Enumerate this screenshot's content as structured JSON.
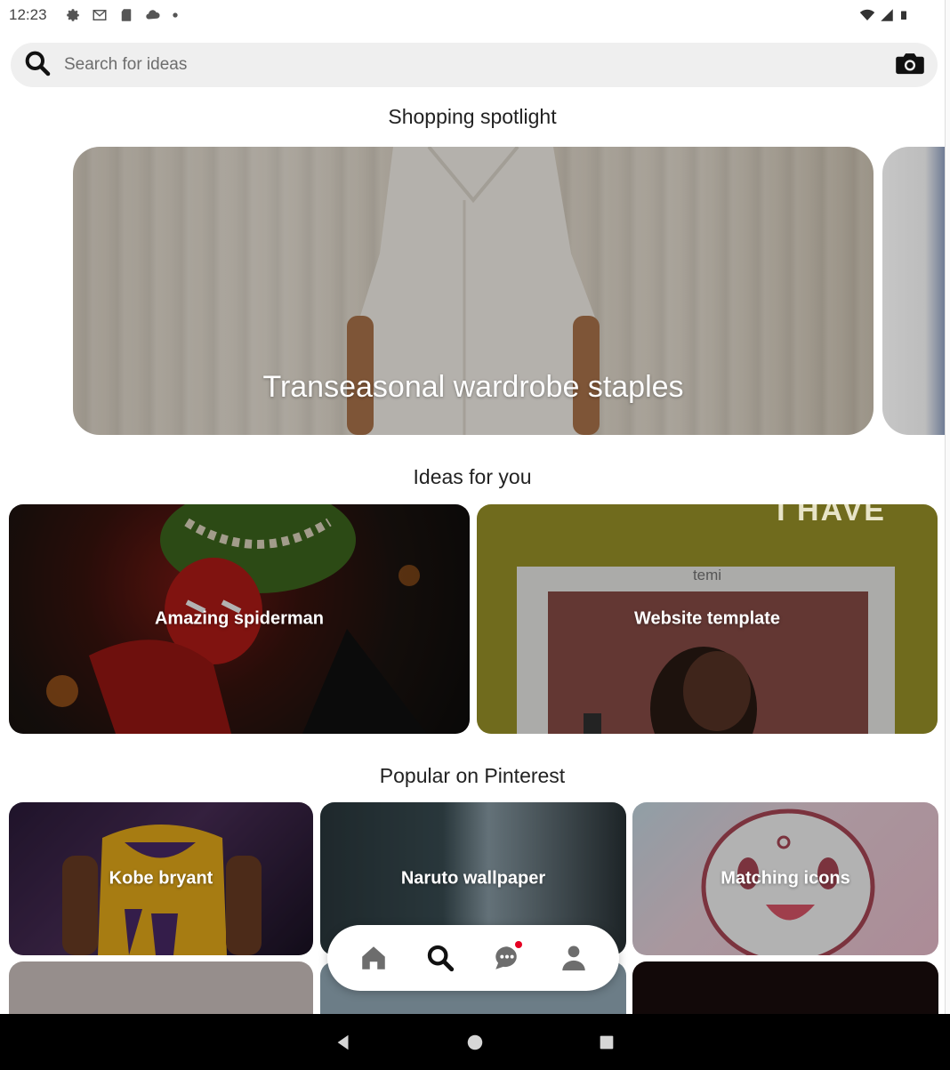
{
  "status_bar": {
    "time": "12:23",
    "left_icons": [
      "settings-icon",
      "gmail-icon",
      "sd-card-icon",
      "cloud-icon",
      "dot-icon"
    ],
    "right_icons": [
      "wifi-icon",
      "signal-icon",
      "battery-icon"
    ]
  },
  "search": {
    "placeholder": "Search for ideas",
    "value": ""
  },
  "shopping_spotlight": {
    "heading": "Shopping spotlight",
    "card_title": "Transeasonal wardrobe staples"
  },
  "ideas_for_you": {
    "heading": "Ideas for you",
    "cards": [
      {
        "label": "Amazing spiderman"
      },
      {
        "label": "Website template",
        "image_text": "temi",
        "image_text_top": "I HAVE"
      }
    ]
  },
  "popular": {
    "heading": "Popular on Pinterest",
    "cards": [
      {
        "label": "Kobe bryant"
      },
      {
        "label": "Naruto wallpaper"
      },
      {
        "label": "Matching icons"
      }
    ]
  },
  "tab_bar": {
    "tabs": [
      "home-icon",
      "search-icon",
      "messages-icon",
      "profile-icon"
    ],
    "active": "search-icon"
  },
  "system_nav": [
    "back-icon",
    "home-circle-icon",
    "recents-icon"
  ],
  "colors": {
    "accent": "#e60023",
    "search_bg": "#efefef",
    "web_template_bg": "#a19a2a"
  }
}
